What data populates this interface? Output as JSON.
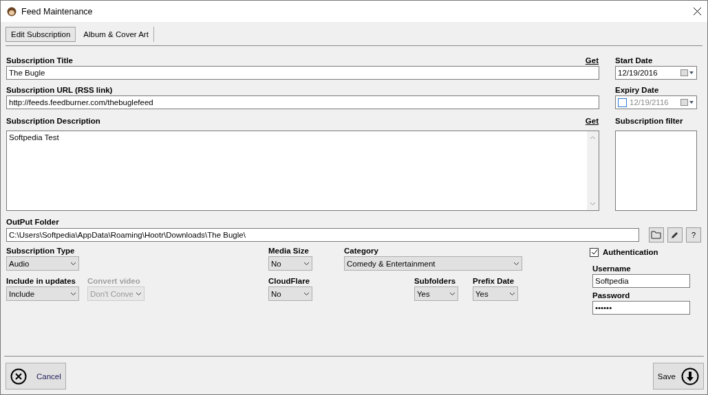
{
  "window": {
    "title": "Feed Maintenance"
  },
  "tabs": [
    {
      "label": "Edit Subscription",
      "selected": true
    },
    {
      "label": "Album & Cover Art",
      "selected": false
    }
  ],
  "title_field": {
    "label": "Subscription Title",
    "link": "Get",
    "value": "The Bugle"
  },
  "url_field": {
    "label": "Subscription URL (RSS link)",
    "value": "http://feeds.feedburner.com/thebuglefeed"
  },
  "description_field": {
    "label": "Subscription  Description",
    "link": "Get",
    "value": "Softpedia Test"
  },
  "start_date": {
    "label": "Start Date",
    "value": "12/19/2016"
  },
  "expiry_date": {
    "label": "Expiry Date",
    "value": "12/19/2116",
    "checked": false
  },
  "filter": {
    "label": "Subscription filter"
  },
  "output_folder": {
    "label": "OutPut Folder",
    "value": "C:\\Users\\Softpedia\\AppData\\Roaming\\Hootr\\Downloads\\The Bugle\\",
    "help": "?"
  },
  "dropdowns": [
    {
      "label": "Subscription Type",
      "value": "Audio",
      "disabled": false
    },
    {
      "label": "Media Size",
      "value": "No",
      "disabled": false
    },
    {
      "label": "Category",
      "value": "Comedy & Entertainment",
      "disabled": false
    },
    {
      "label": "Include in updates",
      "value": "Include",
      "disabled": false
    },
    {
      "label": "Convert video",
      "value": "Don't Conve",
      "disabled": true
    },
    {
      "label": "CloudFlare",
      "value": "No",
      "disabled": false
    },
    {
      "label": "Subfolders",
      "value": "Yes",
      "disabled": false
    },
    {
      "label": "Prefix Date",
      "value": "Yes",
      "disabled": false
    }
  ],
  "authentication": {
    "label": "Authentication",
    "checked": true,
    "username_label": "Username",
    "username": "Softpedia",
    "password_label": "Password",
    "password": "••••••"
  },
  "buttons": {
    "cancel": "Cancel",
    "save": "Save"
  }
}
